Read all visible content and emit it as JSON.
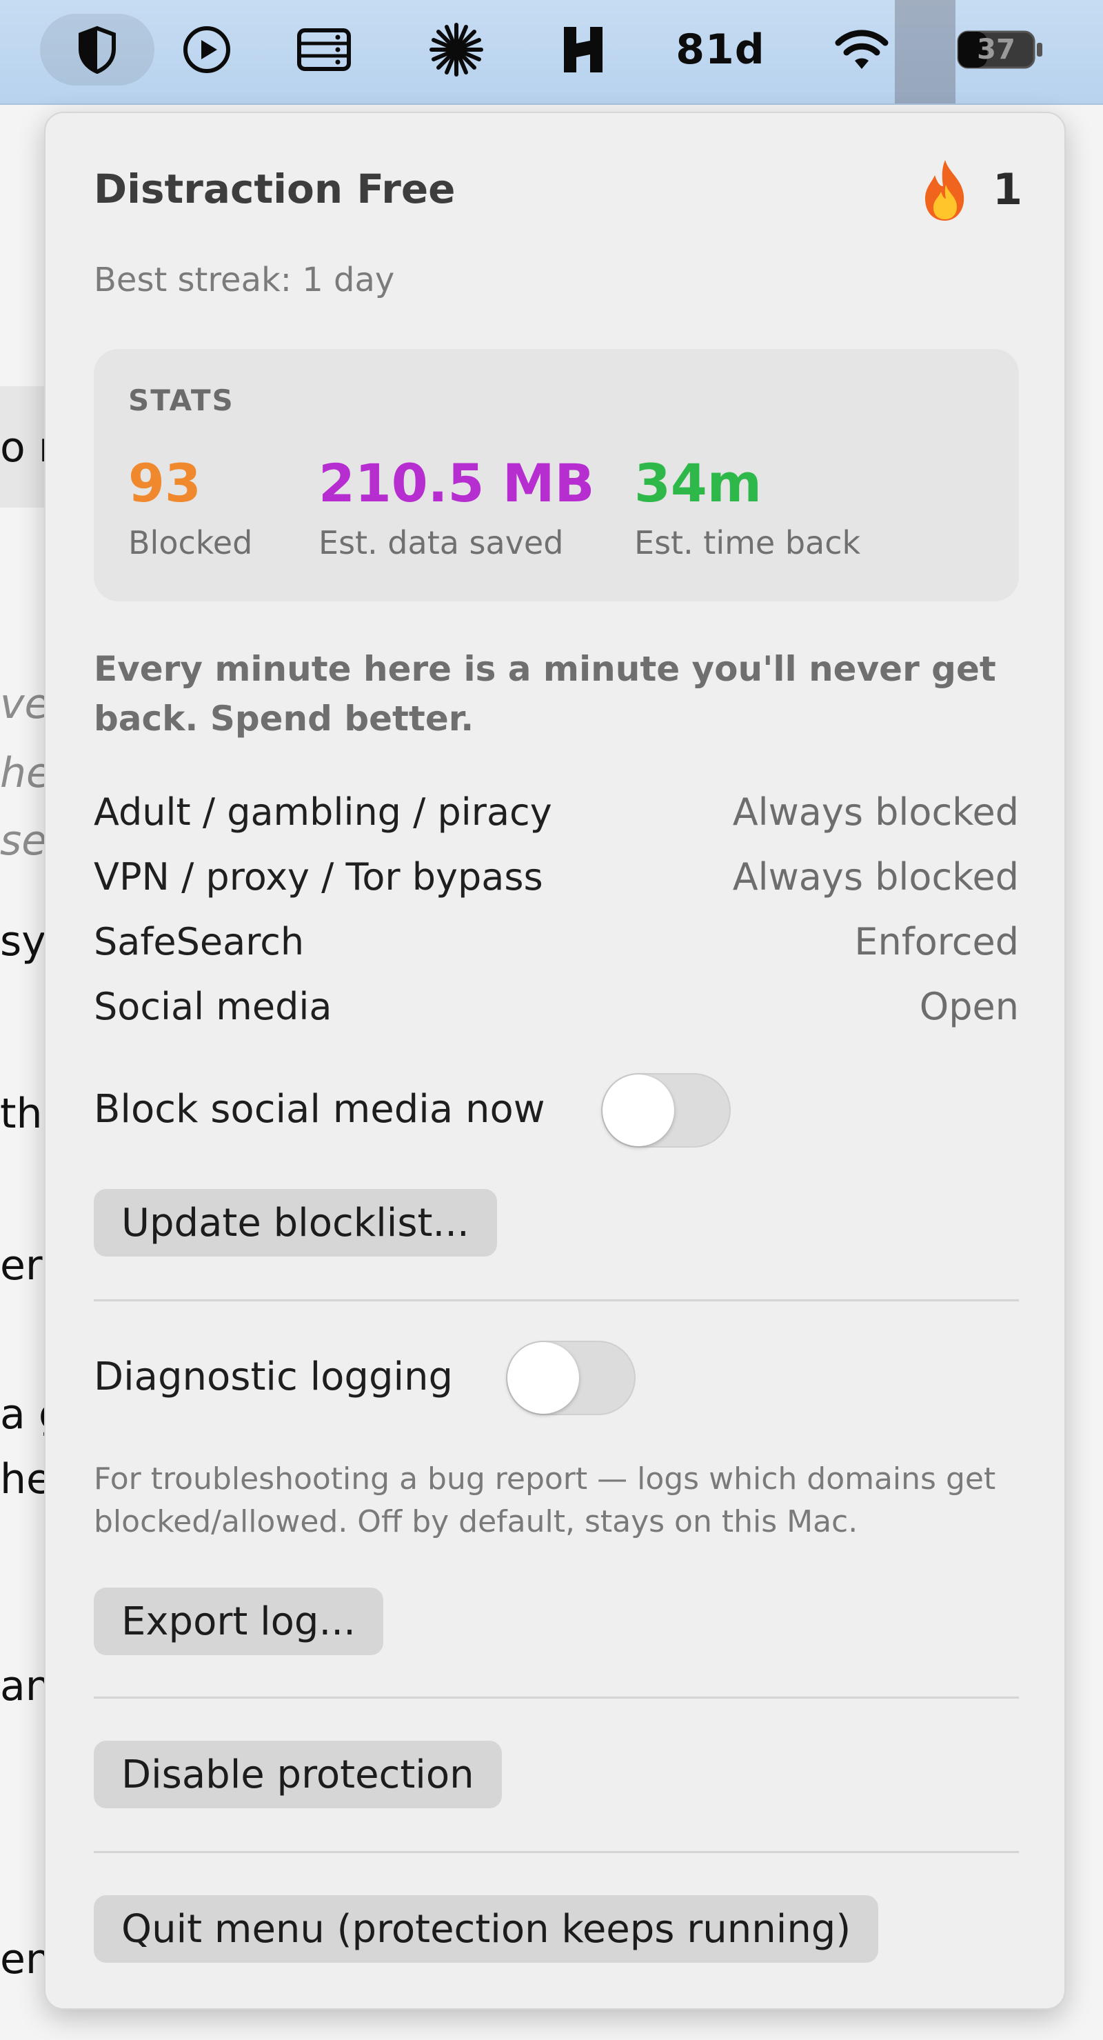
{
  "menubar": {
    "status_text": "81d",
    "battery_level": "37"
  },
  "background": {
    "fragments": [
      "o m",
      "ve",
      "he",
      "ser",
      "sy",
      "th",
      "er",
      "a g",
      "he",
      "anc",
      "en"
    ]
  },
  "panel": {
    "title": "Distraction Free",
    "streak_icon": "fire-icon",
    "streak_count": "1",
    "best_streak": "Best streak: 1 day",
    "stats": {
      "header": "STATS",
      "items": [
        {
          "value": "93",
          "label": "Blocked",
          "color": "#f0892e"
        },
        {
          "value": "210.5 MB",
          "label": "Est. data saved",
          "color": "#b62ed0"
        },
        {
          "value": "34m",
          "label": "Est. time back",
          "color": "#2fb84a"
        }
      ]
    },
    "quote": "Every minute here is a minute you'll never get back. Spend better.",
    "rules": [
      {
        "label": "Adult / gambling / piracy",
        "status": "Always blocked"
      },
      {
        "label": "VPN / proxy / Tor bypass",
        "status": "Always blocked"
      },
      {
        "label": "SafeSearch",
        "status": "Enforced"
      },
      {
        "label": "Social media",
        "status": "Open"
      }
    ],
    "block_social": {
      "label": "Block social media now",
      "on": false
    },
    "update_button": "Update blocklist...",
    "diagnostic": {
      "label": "Diagnostic logging",
      "on": false
    },
    "diagnostic_note": "For troubleshooting a bug report — logs which domains get blocked/allowed. Off by default, stays on this Mac.",
    "export_button": "Export log...",
    "disable_button": "Disable protection",
    "quit_button": "Quit menu (protection keeps running)"
  }
}
